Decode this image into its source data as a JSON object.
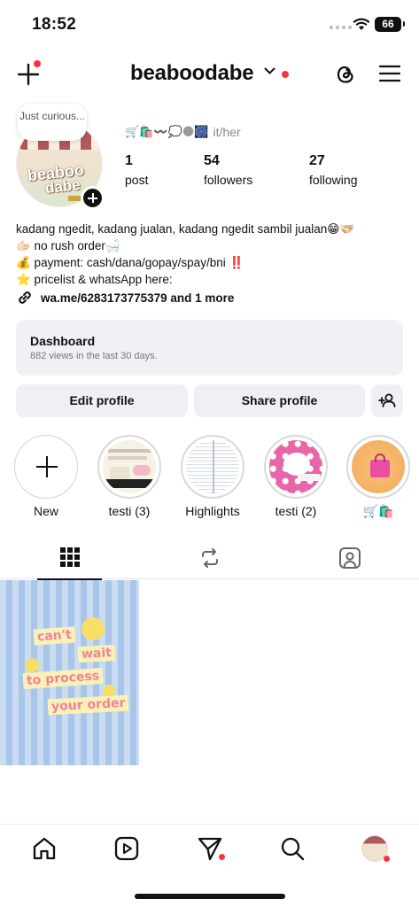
{
  "status_bar": {
    "time": "18:52",
    "battery": "66"
  },
  "header": {
    "username": "beaboodabe"
  },
  "profile": {
    "note": "Just curious...",
    "avatar_text_1": "beaboo",
    "avatar_text_2": "dabe",
    "emojis": "🛒🛍️〰️💭🌑🎆",
    "pronouns": "it/her",
    "stats": [
      {
        "num": "1",
        "label": "post"
      },
      {
        "num": "54",
        "label": "followers"
      },
      {
        "num": "27",
        "label": "following"
      }
    ],
    "bio": {
      "line1": "kadang ngedit, kadang jualan, kadang ngedit sambil jualan😁🫱🏻‍🫲🏼",
      "line2": "🫱🏻 no rush order🛁",
      "line3_prefix": "💰 payment: cash/dana/gopay/spay/bni ",
      "line3_mark": "‼️",
      "line4": "⭐ pricelist & whatsApp here:"
    },
    "link": "wa.me/6283173775379 and 1 more"
  },
  "dashboard": {
    "title": "Dashboard",
    "subtitle": "882 views in the last 30 days."
  },
  "buttons": {
    "edit": "Edit profile",
    "share": "Share profile"
  },
  "highlights": [
    {
      "label": "New"
    },
    {
      "label": "testi (3)"
    },
    {
      "label": "Highlights"
    },
    {
      "label": "testi (2)"
    },
    {
      "label": "🛒🛍️"
    }
  ],
  "post": {
    "words": [
      "can't",
      "wait",
      "to process",
      "your order"
    ]
  },
  "colors": {
    "accent_red": "#ff3040",
    "button_bg": "#eff0f3"
  }
}
